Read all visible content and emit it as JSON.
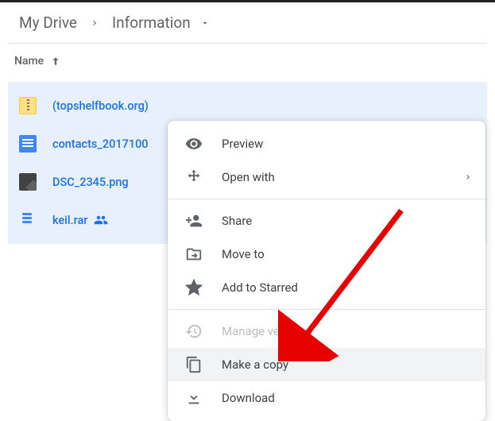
{
  "breadcrumb": {
    "root": "My Drive",
    "current": "Information"
  },
  "column_header": {
    "name": "Name"
  },
  "files": [
    {
      "name": "(topshelfbook.org)",
      "type": "zip",
      "shared": false
    },
    {
      "name": "contacts_2017100",
      "type": "doc",
      "shared": false
    },
    {
      "name": "DSC_2345.png",
      "type": "img",
      "shared": false
    },
    {
      "name": "keil.rar",
      "type": "rar",
      "shared": true
    }
  ],
  "menu": {
    "preview": "Preview",
    "open_with": "Open with",
    "share": "Share",
    "move_to": "Move to",
    "add_starred": "Add to Starred",
    "manage_versions": "Manage versions",
    "make_copy": "Make a copy",
    "download": "Download"
  }
}
